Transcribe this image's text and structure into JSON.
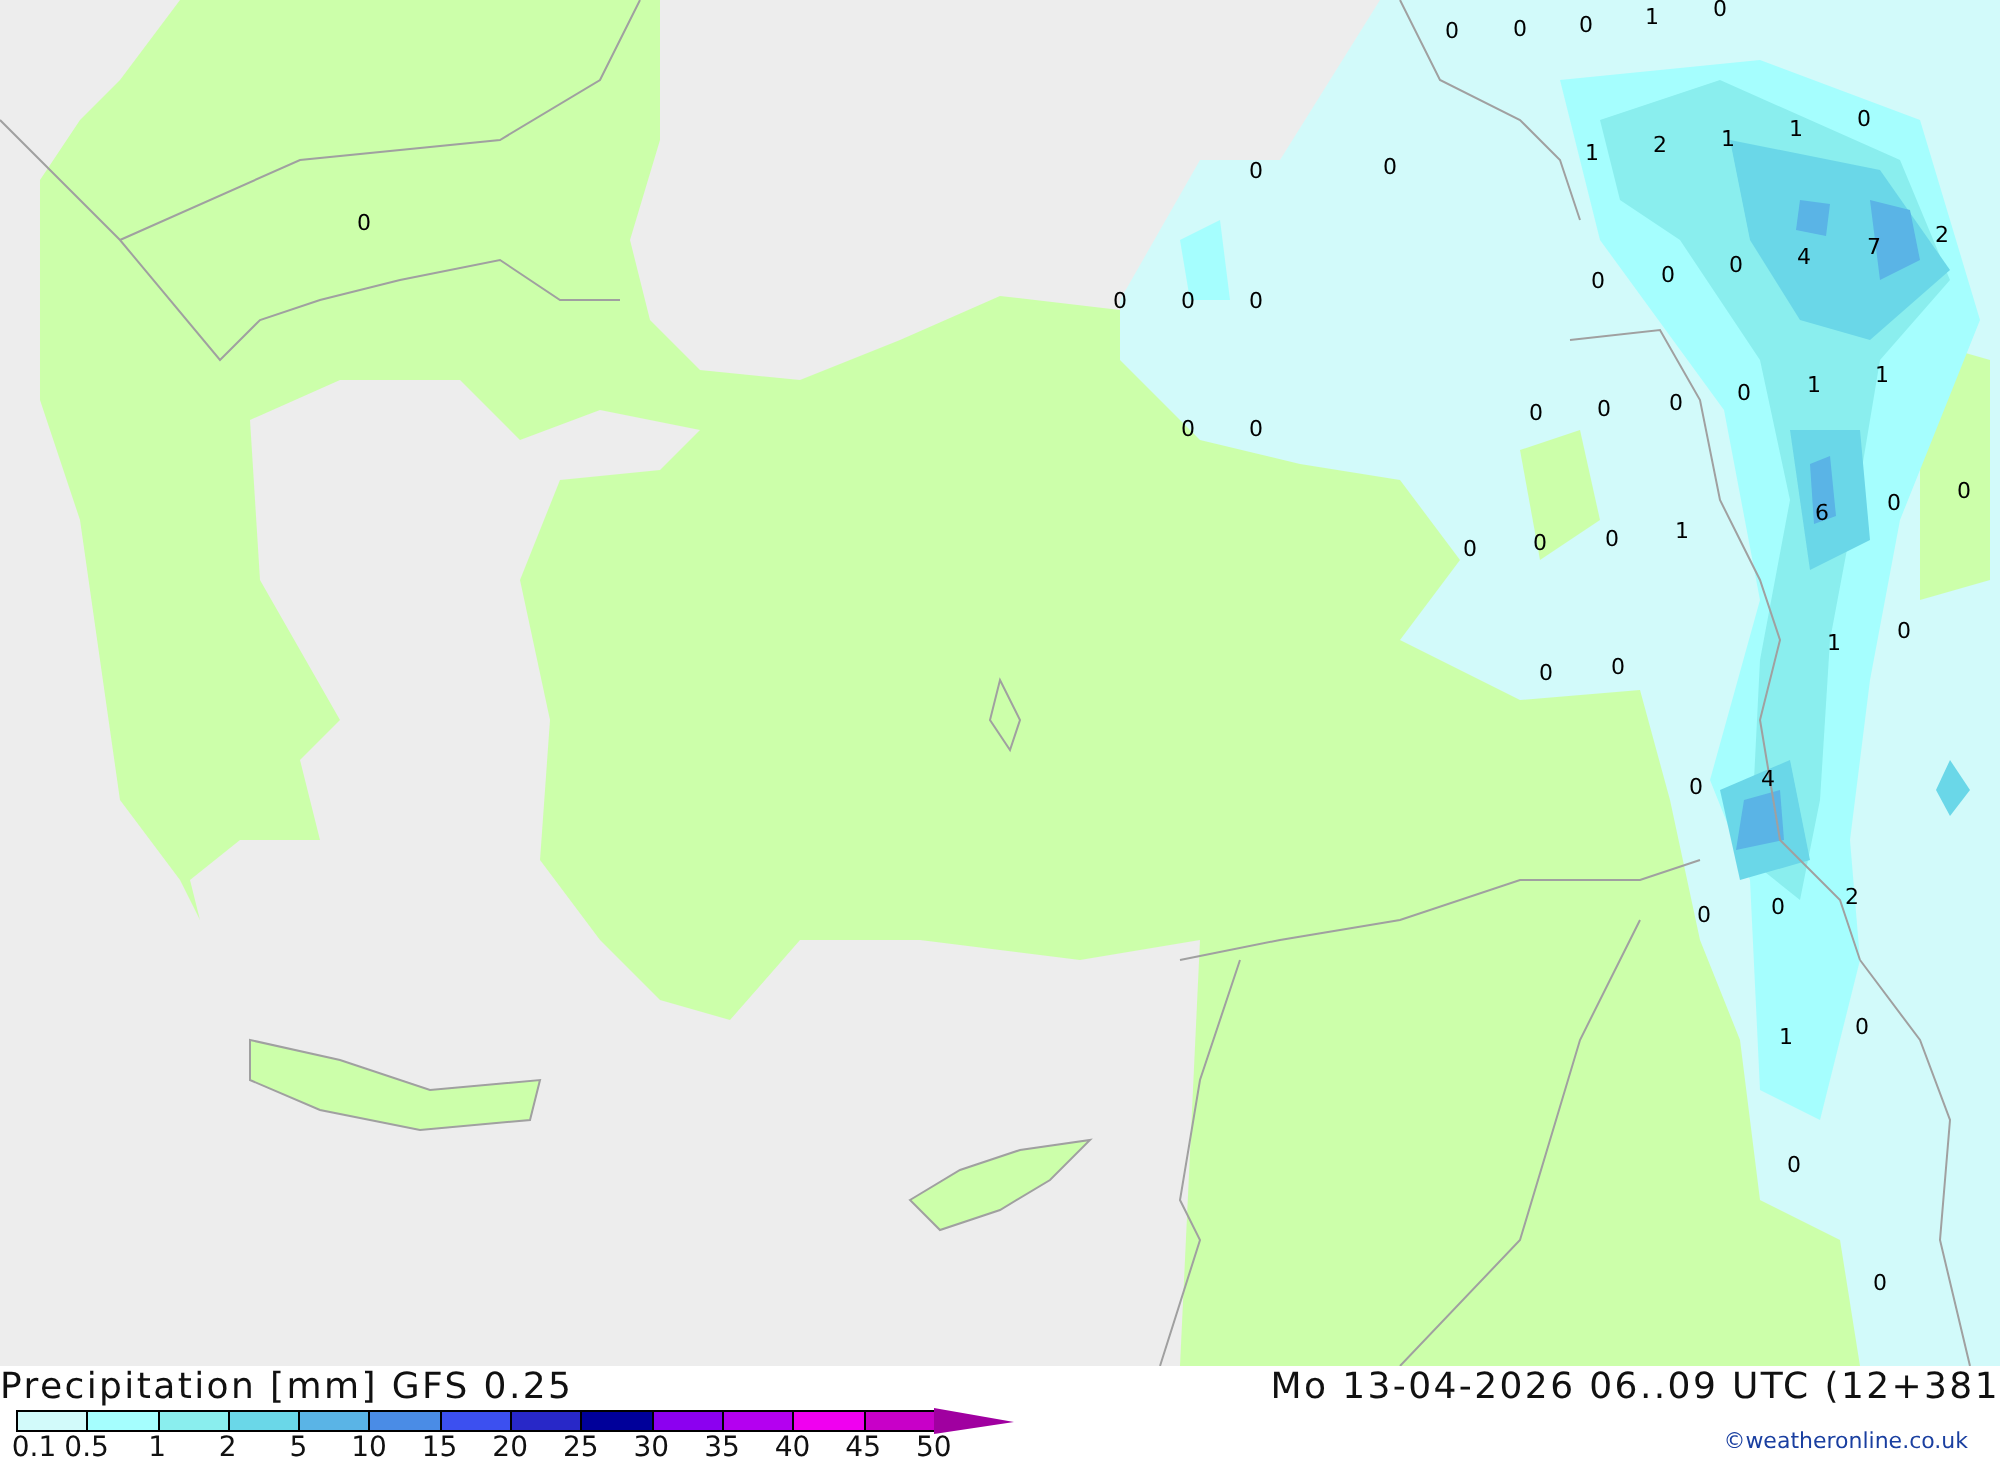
{
  "map": {
    "value_labels": [
      "0",
      "0",
      "0",
      "1",
      "0",
      "0",
      "0",
      "0",
      "1",
      "2",
      "1",
      "1",
      "0",
      "4",
      "7",
      "2",
      "0",
      "0",
      "0",
      "0",
      "0",
      "0",
      "0",
      "1",
      "1",
      "0",
      "0",
      "0",
      "0",
      "0",
      "6",
      "0",
      "0",
      "0",
      "0",
      "0",
      "1",
      "1",
      "0",
      "0",
      "0",
      "0",
      "4",
      "0",
      "0",
      "2",
      "1",
      "0",
      "0",
      "0"
    ]
  },
  "footer": {
    "title": "Precipitation [mm] GFS 0.25",
    "datetime": "Mo 13-04-2026 06..09 UTC (12+381",
    "credit": "©weatheronline.co.uk"
  },
  "legend": {
    "steps": [
      {
        "label": "0.1",
        "color": "#d2fafa"
      },
      {
        "label": "0.5",
        "color": "#a5fefe"
      },
      {
        "label": "1",
        "color": "#8aeeee"
      },
      {
        "label": "2",
        "color": "#6ad7e8"
      },
      {
        "label": "5",
        "color": "#5ab4e6"
      },
      {
        "label": "10",
        "color": "#4a8ce6"
      },
      {
        "label": "15",
        "color": "#3c50f0"
      },
      {
        "label": "20",
        "color": "#2828c8"
      },
      {
        "label": "25",
        "color": "#00009a"
      },
      {
        "label": "30",
        "color": "#8c00f0"
      },
      {
        "label": "35",
        "color": "#b400f0"
      },
      {
        "label": "40",
        "color": "#f000f0"
      },
      {
        "label": "45",
        "color": "#c800c8"
      },
      {
        "label": "50",
        "color": "#a000a0"
      }
    ]
  }
}
